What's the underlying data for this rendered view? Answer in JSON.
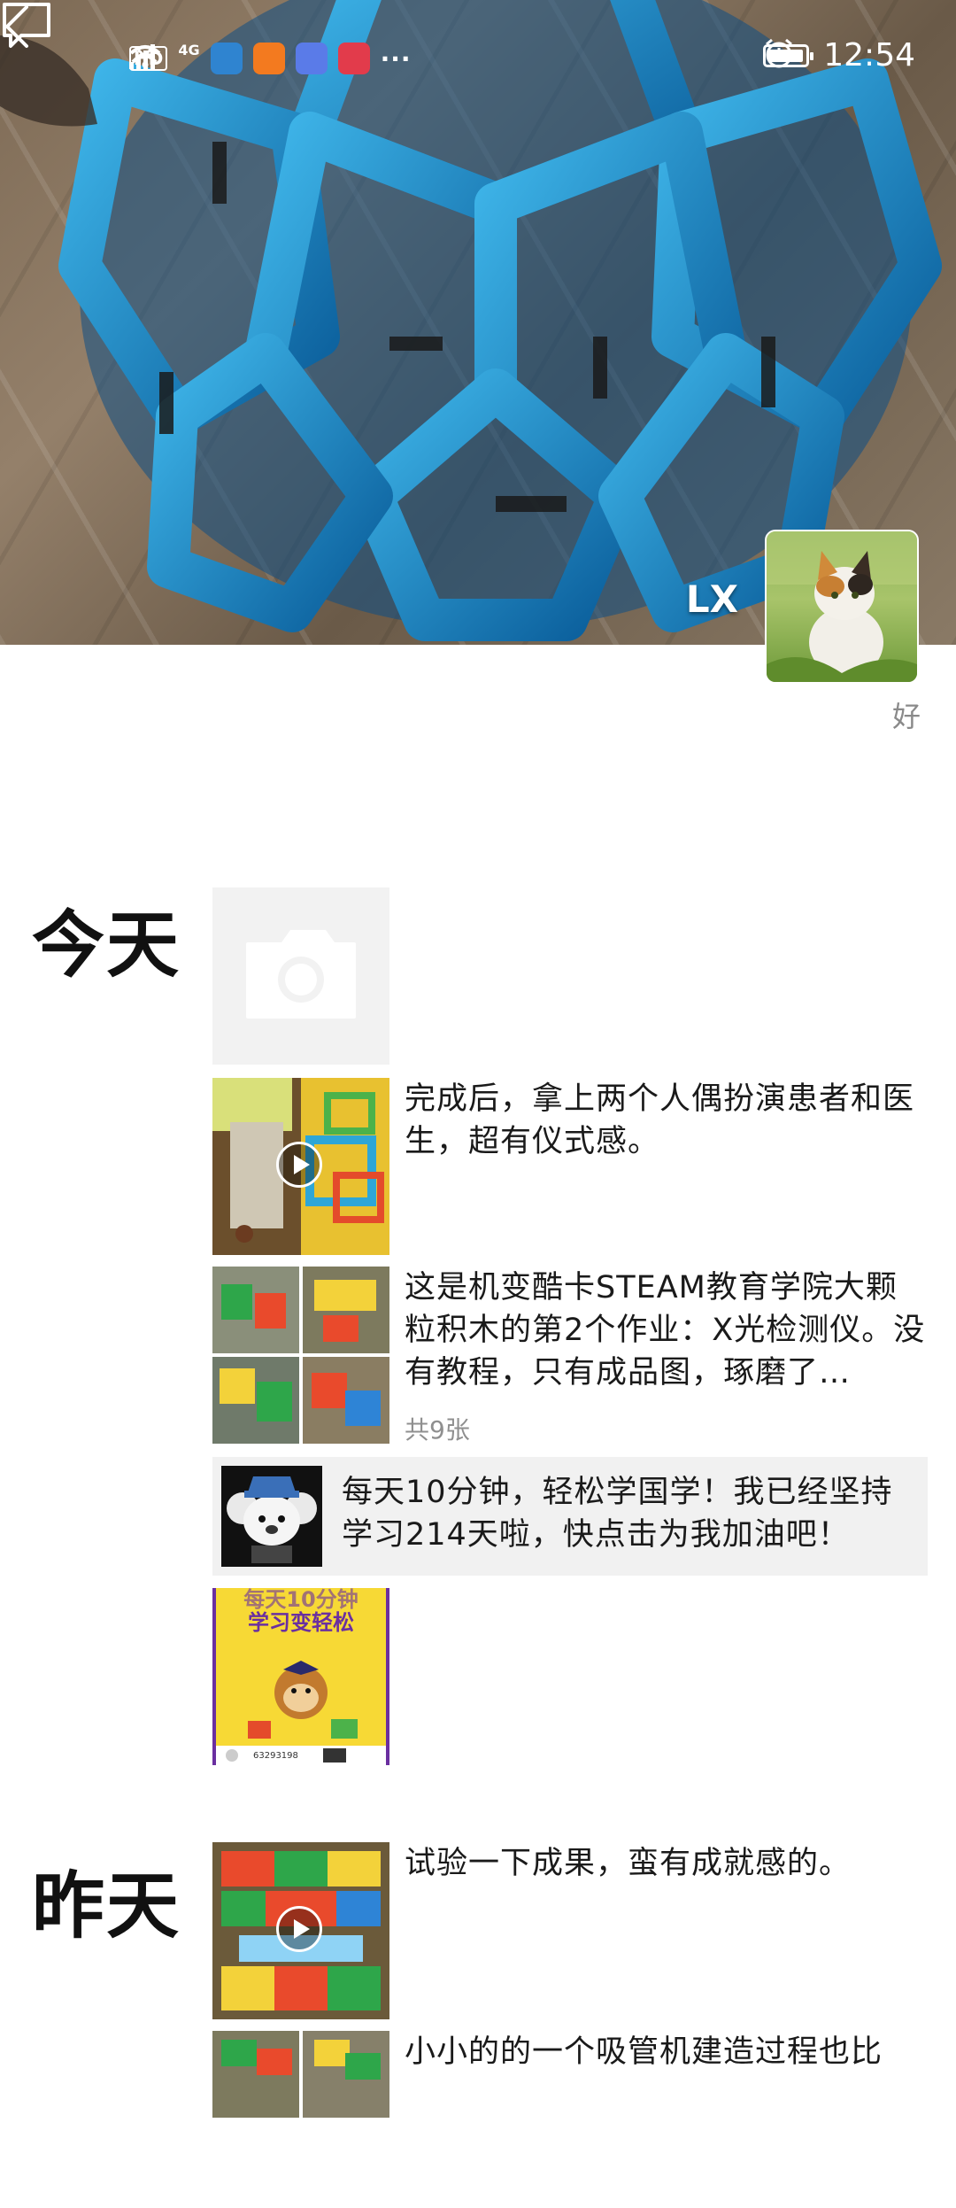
{
  "status_bar": {
    "hd": "HD",
    "network": "4G",
    "more": "···",
    "time": "12:54"
  },
  "profile": {
    "name": "LX",
    "signature": "好"
  },
  "icons": {
    "back": "chevron-left-icon",
    "comment": "message-bubble-icon",
    "camera": "camera-icon",
    "play": "play-icon"
  },
  "feed": {
    "days": [
      {
        "label": "今天"
      },
      {
        "label": "昨天"
      }
    ],
    "posts": [
      {
        "text": "完成后，拿上两个人偶扮演患者和医生，超有仪式感。"
      },
      {
        "text": "这是机变酷卡STEAM教育学院大颗粒积木的第2个作业：X光检测仪。没有教程，只有成品图，琢磨了…",
        "count": "共9张"
      },
      {
        "share_text": "每天10分钟，轻松学国学！我已经坚持学习214天啦，快点击为我加油吧！"
      },
      {
        "poster_line1": "每天10分钟",
        "poster_line2": "学习变轻松",
        "poster_code": "63293198"
      },
      {
        "text": "试验一下成果，蛮有成就感的。"
      },
      {
        "text": "小小的的一个吸管机建造过程也比"
      }
    ]
  },
  "colors": {
    "accent_blue": "#1f8fd0",
    "muted_text": "#8a8a8a",
    "card_bg": "#f1f1f1"
  }
}
